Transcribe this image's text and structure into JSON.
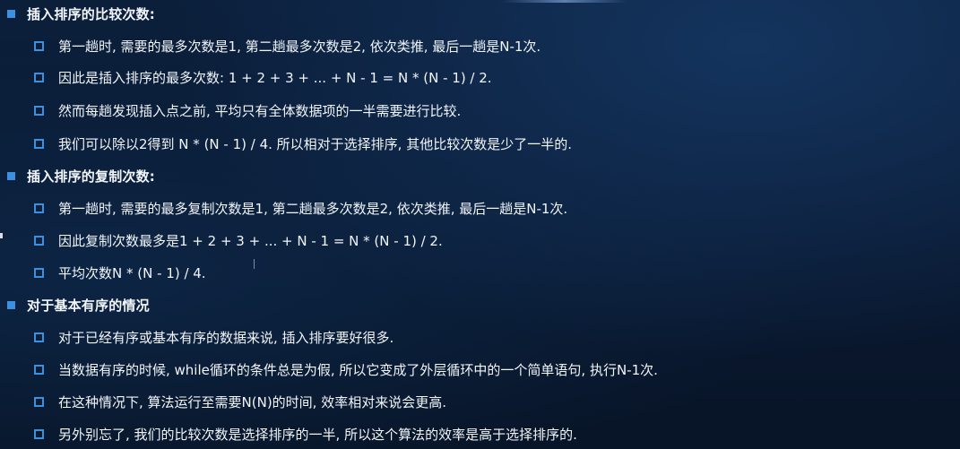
{
  "colors": {
    "bullet": "#3d8fe0",
    "text": "#f2f5fa",
    "background": "#0a1a33"
  },
  "sections": [
    {
      "heading": "插入排序的比较次数:",
      "items": [
        "第一趟时, 需要的最多次数是1, 第二趟最多次数是2, 依次类推, 最后一趟是N-1次.",
        "因此是插入排序的最多次数: 1 + 2 + 3 + ... + N - 1 = N * (N - 1) / 2.",
        "然而每趟发现插入点之前, 平均只有全体数据项的一半需要进行比较.",
        "我们可以除以2得到 N * (N - 1) / 4. 所以相对于选择排序, 其他比较次数是少了一半的."
      ]
    },
    {
      "heading": "插入排序的复制次数:",
      "items": [
        "第一趟时, 需要的最多复制次数是1, 第二趟最多次数是2, 依次类推, 最后一趟是N-1次.",
        "因此复制次数最多是1 + 2 + 3 + ... + N - 1 = N * (N - 1) / 2.",
        "平均次数N * (N - 1) / 4."
      ]
    },
    {
      "heading": "对于基本有序的情况",
      "items": [
        "对于已经有序或基本有序的数据来说, 插入排序要好很多.",
        "当数据有序的时候, while循环的条件总是为假, 所以它变成了外层循环中的一个简单语句, 执行N-1次.",
        "在这种情况下, 算法运行至需要N(N)的时间, 效率相对来说会更高.",
        "另外别忘了, 我们的比较次数是选择排序的一半, 所以这个算法的效率是高于选择排序的."
      ]
    }
  ]
}
